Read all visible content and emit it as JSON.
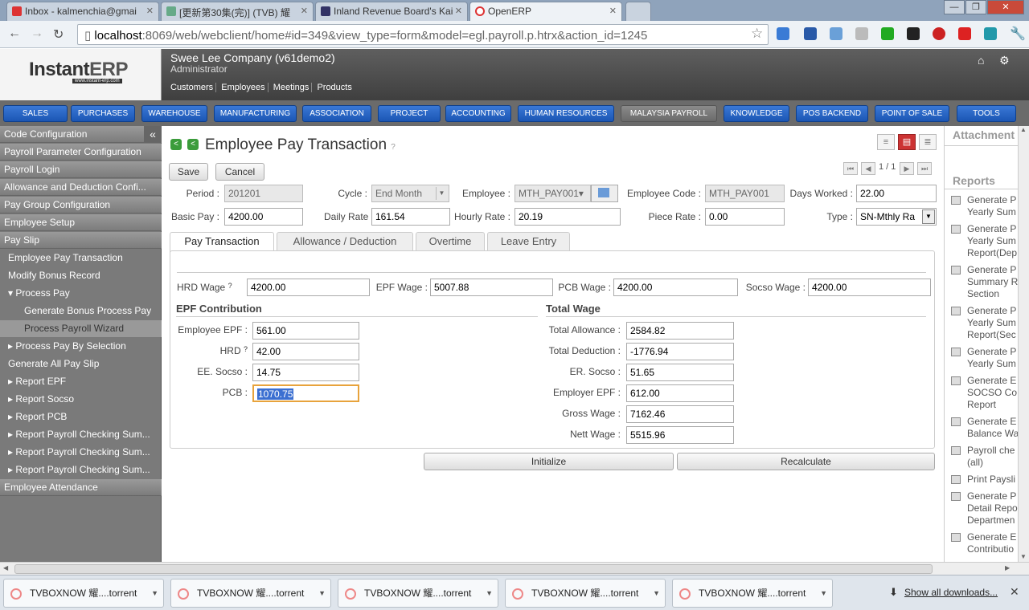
{
  "browser": {
    "tabs": [
      {
        "label": "Inbox - kalmenchia@gmai",
        "color": "#d33"
      },
      {
        "label": "[更新第30集(完)] (TVB) 耀",
        "color": "#6a8"
      },
      {
        "label": "Inland Revenue Board's Kai",
        "color": "#336"
      },
      {
        "label": "OpenERP",
        "color": "#d33"
      }
    ],
    "close_glyph": "✕",
    "url_host": "localhost",
    "url_rest": ":8069/web/webclient/home#id=349&view_type=form&model=egl.payroll.p.htrx&action_id=1245",
    "window_controls": [
      "—",
      "❐",
      "✕"
    ]
  },
  "app": {
    "logo_text_a": "Instant",
    "logo_text_b": "ERP",
    "logo_sub": "www.instant-erp.com",
    "company": "Swee Lee Company (v61demo2)",
    "user": "Administrator",
    "shortcuts": [
      "Customers",
      "Employees",
      "Meetings",
      "Products"
    ]
  },
  "menu": [
    "SALES",
    "PURCHASES",
    "WAREHOUSE",
    "MANUFACTURING",
    "ASSOCIATION",
    "PROJECT",
    "ACCOUNTING",
    "HUMAN RESOURCES",
    "MALAYSIA PAYROLL",
    "KNOWLEDGE",
    "POS BACKEND",
    "POINT OF SALE",
    "TOOLS"
  ],
  "sidebar": {
    "collapse_glyph": "«",
    "headers": [
      "Code Configuration",
      "Payroll Parameter Configuration",
      "Payroll Login",
      "Allowance and Deduction Confi...",
      "Pay Group Configuration",
      "Employee Setup",
      "Pay Slip",
      "Employee Attendance"
    ],
    "items": [
      "Employee Pay Transaction",
      "Modify Bonus Record",
      "▾ Process Pay",
      "Generate Bonus Process Pay",
      "Process Payroll Wizard",
      "▸ Process Pay By Selection",
      "Generate All Pay Slip",
      "▸ Report EPF",
      "▸ Report Socso",
      "▸ Report PCB",
      "▸ Report Payroll Checking Sum...",
      "▸ Report Payroll Checking Sum...",
      "▸ Report Payroll Checking Sum..."
    ]
  },
  "form": {
    "title": "Employee Pay Transaction",
    "help": "?",
    "pager": "1 / 1",
    "save": "Save",
    "cancel": "Cancel",
    "period_label": "Period :",
    "period": "201201",
    "cycle_label": "Cycle :",
    "cycle": "End Month",
    "employee_label": "Employee :",
    "employee": "MTH_PAY001▾",
    "empcode_label": "Employee Code :",
    "empcode": "MTH_PAY001",
    "days_label": "Days Worked :",
    "days": "22.00",
    "basic_label": "Basic Pay :",
    "basic": "4200.00",
    "daily_label": "Daily Rate",
    "daily": "161.54",
    "hourly_label": "Hourly Rate :",
    "hourly": "20.19",
    "piece_label": "Piece Rate :",
    "piece": "0.00",
    "type_label": "Type :",
    "type": "SN-Mthly Ra",
    "tabs": [
      "Pay Transaction",
      "Allowance / Deduction",
      "Overtime",
      "Leave Entry"
    ],
    "hrd_wage_label": "HRD Wage",
    "hrd_wage": "4200.00",
    "epf_wage_label": "EPF Wage :",
    "epf_wage": "5007.88",
    "pcb_wage_label": "PCB Wage :",
    "pcb_wage": "4200.00",
    "socso_wage_label": "Socso Wage :",
    "socso_wage": "4200.00",
    "epf_contrib_title": "EPF Contribution",
    "total_wage_title": "Total Wage",
    "emp_epf_label": "Employee EPF :",
    "emp_epf": "561.00",
    "hrd_label": "HRD",
    "hrd": "42.00",
    "ee_socso_label": "EE. Socso :",
    "ee_socso": "14.75",
    "pcb_label": "PCB :",
    "pcb": "1070.75",
    "tot_allow_label": "Total Allowance :",
    "tot_allow": "2584.82",
    "tot_ded_label": "Total Deduction :",
    "tot_ded": "-1776.94",
    "er_socso_label": "ER. Socso :",
    "er_socso": "51.65",
    "er_epf_label": "Employer EPF :",
    "er_epf": "612.00",
    "gross_label": "Gross Wage :",
    "gross": "7162.46",
    "nett_label": "Nett Wage :",
    "nett": "5515.96",
    "initialize": "Initialize",
    "recalculate": "Recalculate"
  },
  "rpanel": {
    "attachment": "Attachment",
    "reports_title": "Reports",
    "reports": [
      [
        "Generate P",
        "Yearly Sum"
      ],
      [
        "Generate P",
        "Yearly Sum",
        "Report(Dep"
      ],
      [
        "Generate P",
        "Summary R",
        "Section"
      ],
      [
        "Generate P",
        "Yearly Sum",
        "Report(Sec"
      ],
      [
        "Generate P",
        "Yearly Sum"
      ],
      [
        "Generate E",
        "SOCSO Co",
        "Report"
      ],
      [
        "Generate E",
        "Balance Wa"
      ],
      [
        "Payroll che",
        "(all)"
      ],
      [
        "Print Paysli"
      ],
      [
        "Generate P",
        "Detail Repo",
        "Departmen"
      ],
      [
        "Generate E",
        "Contributio"
      ]
    ]
  },
  "downloads": {
    "items": [
      "TVBOXNOW 耀....torrent",
      "TVBOXNOW 耀....torrent",
      "TVBOXNOW 耀....torrent",
      "TVBOXNOW 耀....torrent",
      "TVBOXNOW 耀....torrent"
    ],
    "show_all": "Show all downloads...",
    "close": "✕"
  }
}
